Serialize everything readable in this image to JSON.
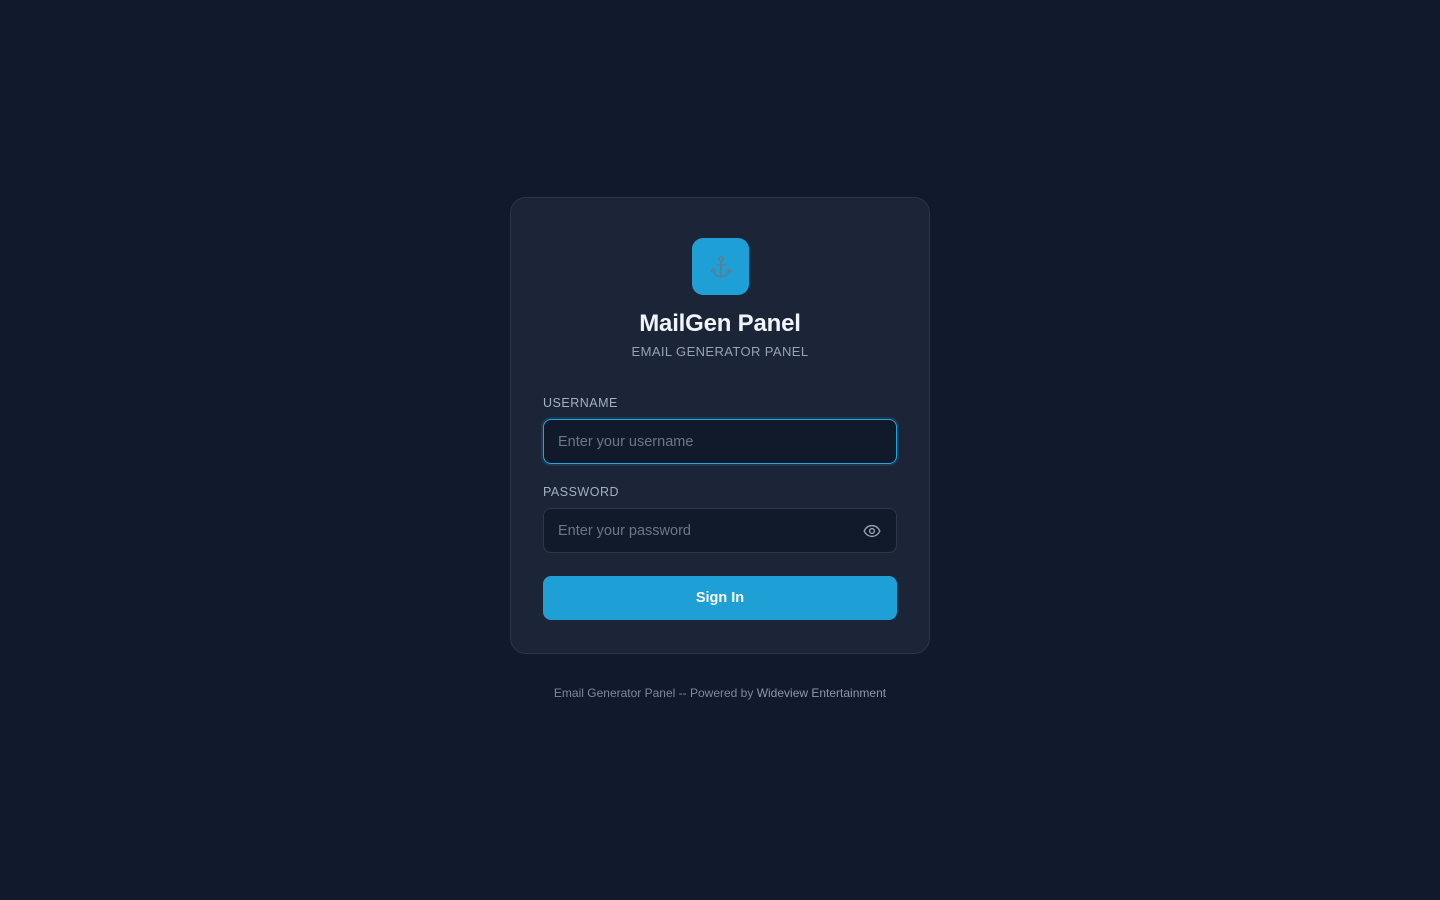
{
  "app": {
    "title": "MailGen Panel",
    "subtitle": "EMAIL GENERATOR PANEL",
    "logo_icon": "anchor-icon",
    "accent_color": "#1e9fd6"
  },
  "form": {
    "username": {
      "label": "USERNAME",
      "placeholder": "Enter your username",
      "value": ""
    },
    "password": {
      "label": "PASSWORD",
      "placeholder": "Enter your password",
      "value": "",
      "toggle_icon": "eye-icon"
    },
    "submit_label": "Sign In"
  },
  "footer": {
    "text": "Email Generator Panel -- Powered by ",
    "brand": "Wideview Entertainment"
  }
}
